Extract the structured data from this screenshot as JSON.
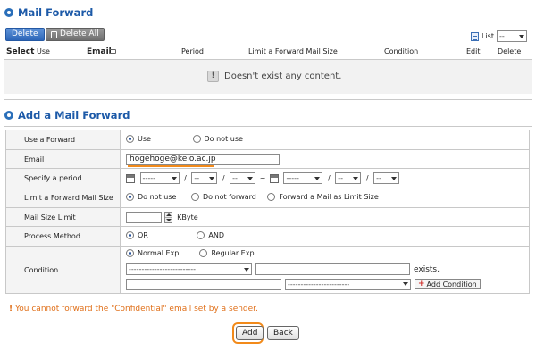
{
  "section1": {
    "title": "Mail Forward",
    "delete_label": "Delete",
    "delete_all_label": "Delete All",
    "list_label": "List",
    "list_select_value": "--",
    "columns": {
      "select": "Select",
      "use": "Use",
      "email": "Email",
      "period": "Period",
      "limit": "Limit a Forward Mail Size",
      "condition": "Condition",
      "edit": "Edit",
      "delete": "Delete"
    },
    "empty_message": "Doesn't exist any content."
  },
  "section2": {
    "title": "Add a Mail Forward",
    "rows": {
      "use_forward": {
        "label": "Use a Forward",
        "options": [
          "Use",
          "Do not use"
        ],
        "selected": "Use"
      },
      "email": {
        "label": "Email",
        "value": "hogehoge@keio.ac.jp"
      },
      "period": {
        "label": "Specify a period",
        "year_placeholder": "-----",
        "month_placeholder": "--",
        "day_placeholder": "--",
        "hour_placeholder": "--",
        "slash": "/",
        "tilde": "~"
      },
      "limit": {
        "label": "Limit a Forward Mail Size",
        "options": [
          "Do not use",
          "Do not forward",
          "Forward a Mail as Limit Size"
        ],
        "selected": "Do not use"
      },
      "size_limit": {
        "label": "Mail Size Limit",
        "unit": "KByte"
      },
      "process": {
        "label": "Process Method",
        "options": [
          "OR",
          "AND"
        ],
        "selected": "OR"
      },
      "condition": {
        "label": "Condition",
        "options": [
          "Normal Exp.",
          "Regular Exp."
        ],
        "selected": "Normal Exp.",
        "field_select_placeholder": "--------------------------",
        "match_select_placeholder": "------------------------",
        "exists_text": "exists,",
        "add_condition_label": "Add Condition"
      }
    },
    "notice": "You cannot forward the \"Confidential\" email set by a sender.",
    "add_label": "Add",
    "back_label": "Back"
  },
  "colors": {
    "title_blue": "#1d5aa8",
    "accent_orange": "#f28a1a"
  }
}
